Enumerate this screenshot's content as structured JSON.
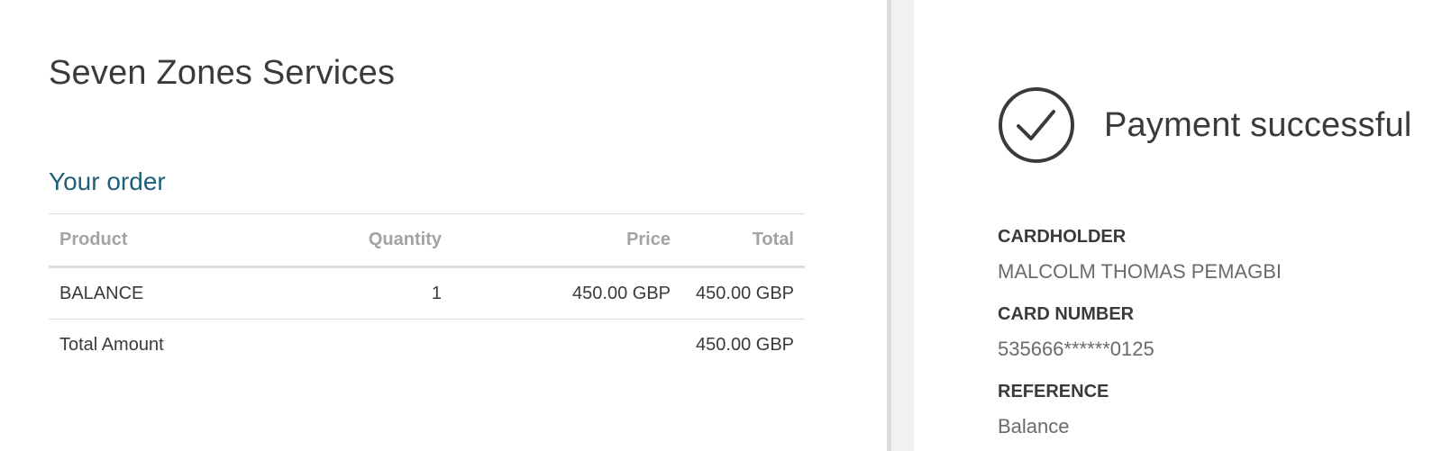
{
  "merchant": {
    "name": "Seven Zones Services"
  },
  "order": {
    "heading": "Your order",
    "columns": {
      "product": "Product",
      "quantity": "Quantity",
      "price": "Price",
      "total": "Total"
    },
    "items": [
      {
        "product": "BALANCE",
        "quantity": "1",
        "price": "450.00 GBP",
        "total": "450.00 GBP"
      }
    ],
    "total_label": "Total Amount",
    "total_amount": "450.00 GBP"
  },
  "payment": {
    "status_text": "Payment successful",
    "status_icon": "check-circle-icon",
    "cardholder_label": "CARDHOLDER",
    "cardholder_value": "MALCOLM THOMAS PEMAGBI",
    "card_number_label": "CARD NUMBER",
    "card_number_value": "535666******0125",
    "reference_label": "REFERENCE",
    "reference_value": "Balance"
  },
  "colors": {
    "heading_accent": "#1f5f7a",
    "text": "#3a3a3a",
    "muted": "#a3a3a3"
  }
}
